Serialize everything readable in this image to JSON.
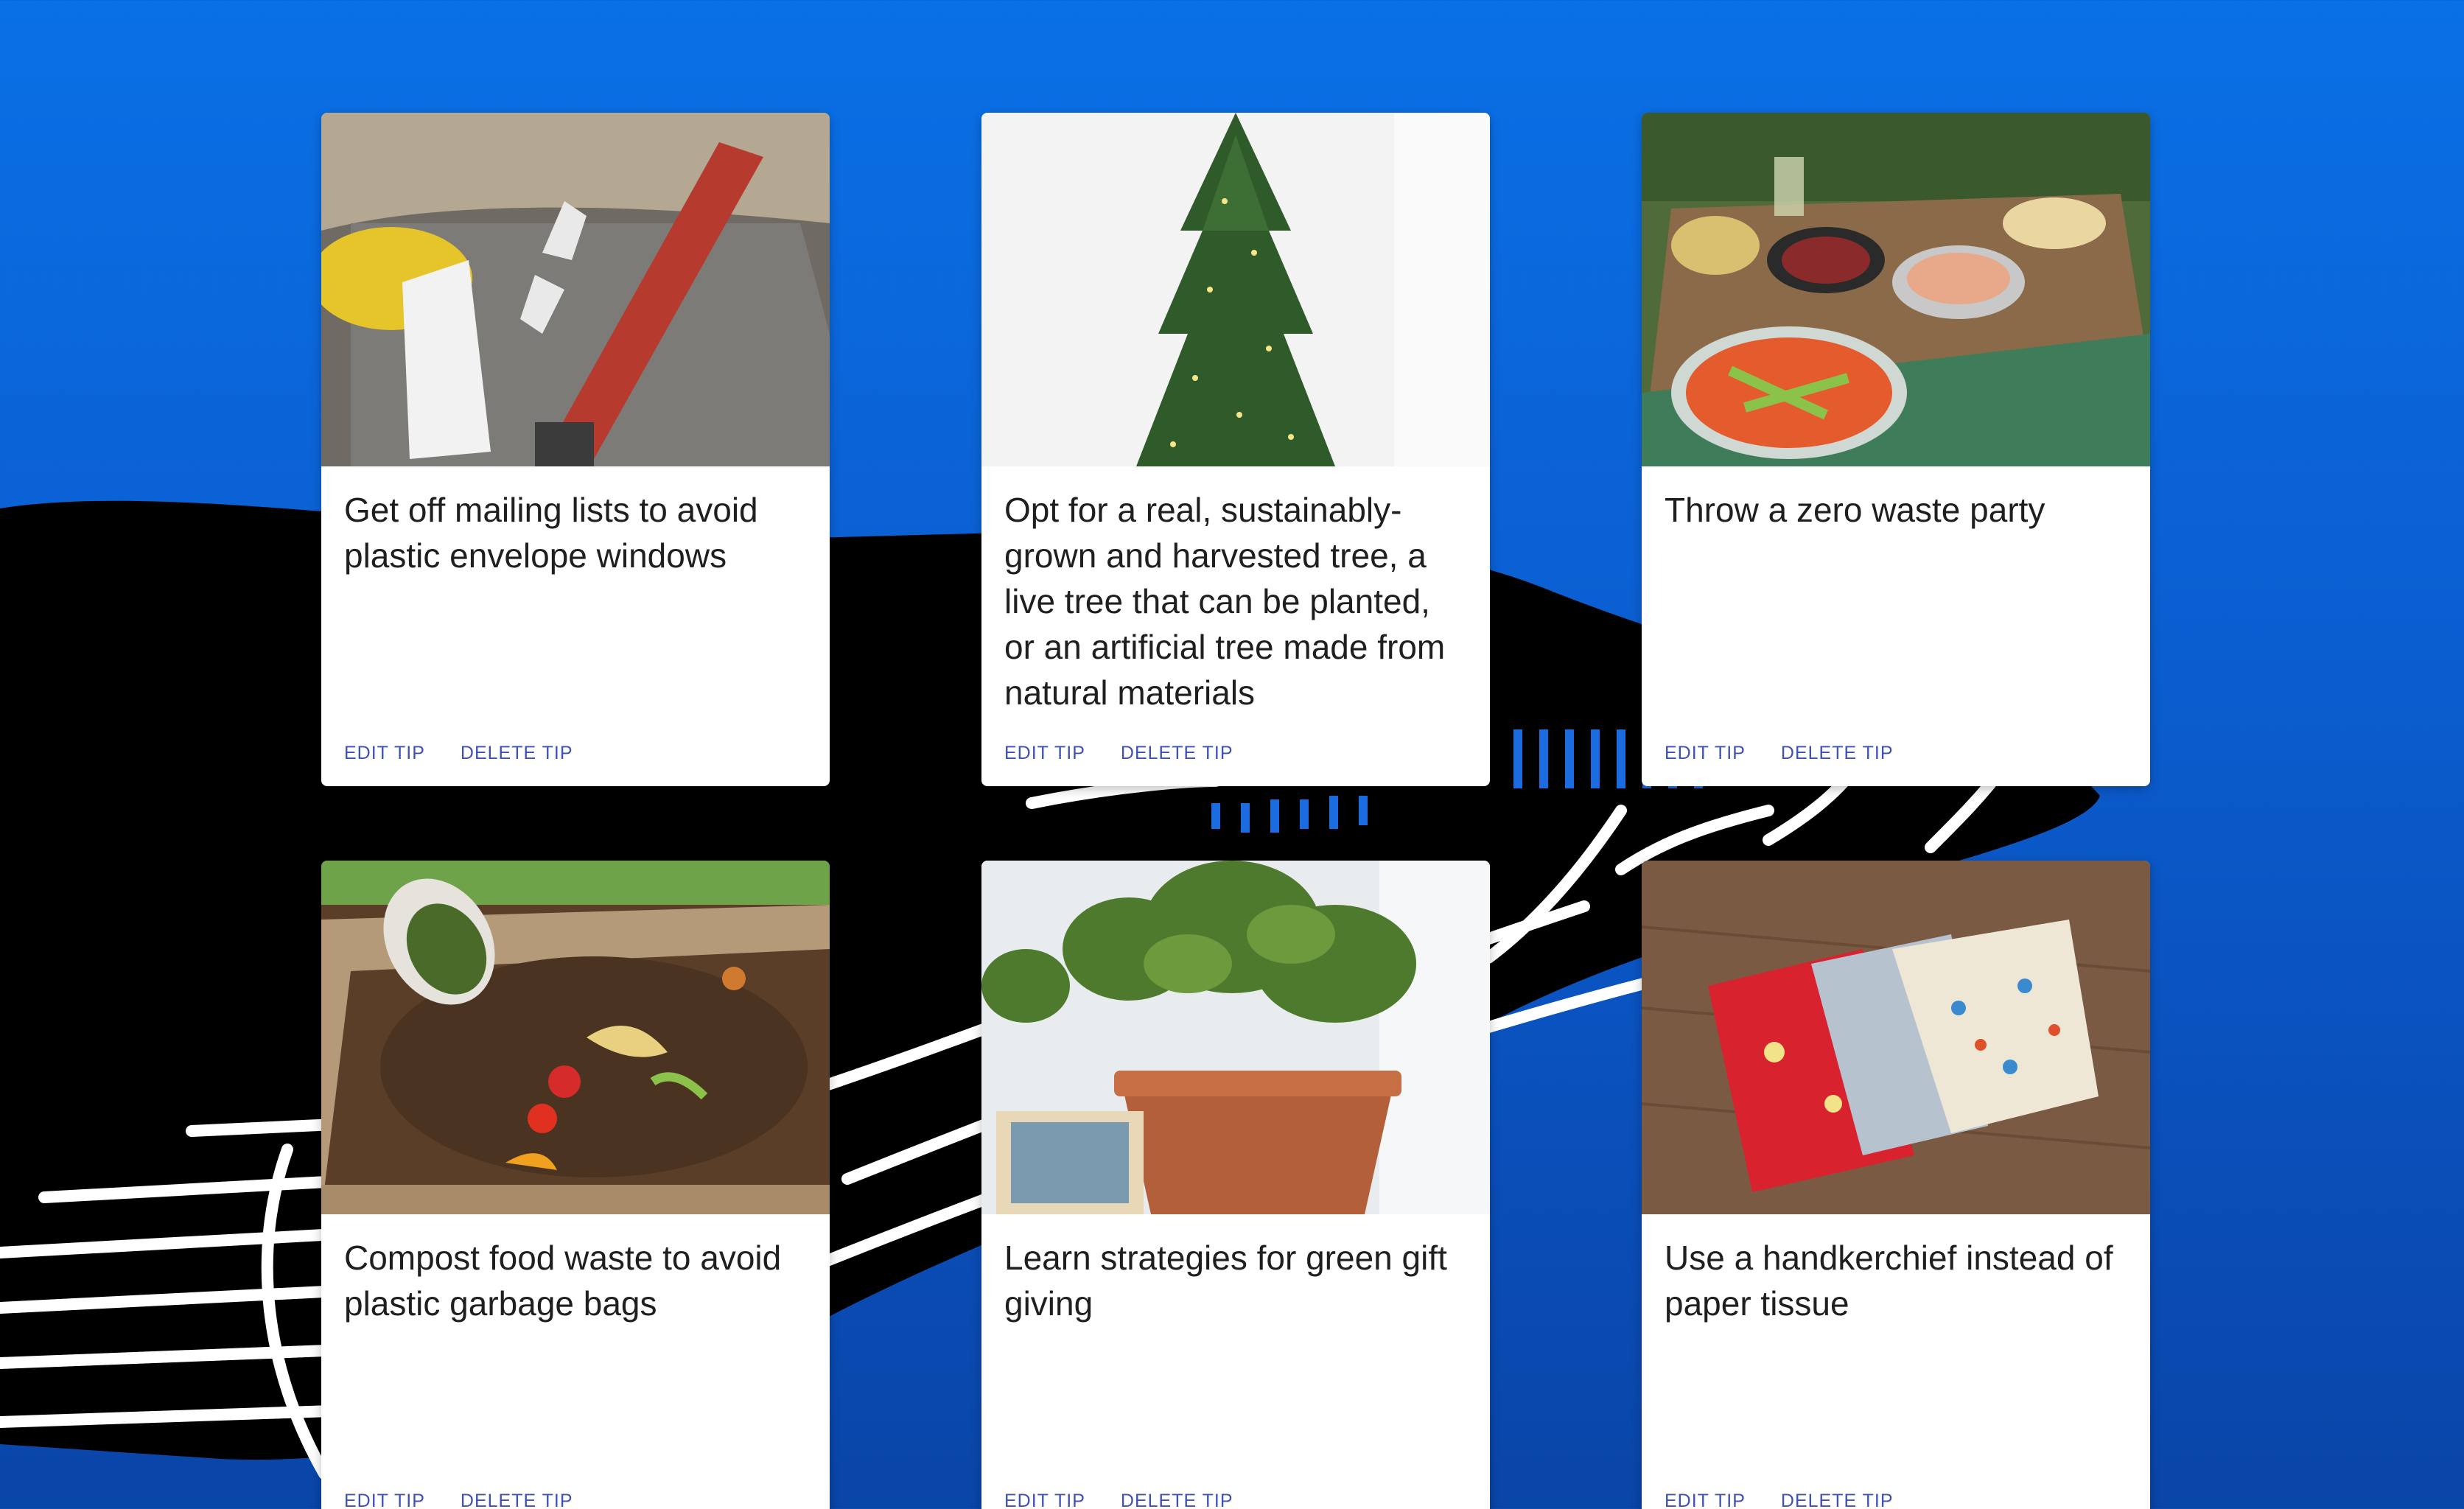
{
  "theme": {
    "accent": "#3f51b5",
    "background": "#0b5fd2"
  },
  "cards": [
    {
      "title": "Get off mailing lists to avoid plastic envelope windows",
      "image_icon": "mailbox-image",
      "edit_label": "EDIT TIP",
      "delete_label": "DELETE TIP"
    },
    {
      "title": "Opt for a real, sustainably-grown and harvested tree, a live tree that can be planted, or an artificial tree made from natural materials",
      "image_icon": "christmas-tree-image",
      "edit_label": "EDIT TIP",
      "delete_label": "DELETE TIP"
    },
    {
      "title": "Throw a zero waste party",
      "image_icon": "party-table-image",
      "edit_label": "EDIT TIP",
      "delete_label": "DELETE TIP"
    },
    {
      "title": "Compost food waste to avoid plastic garbage bags",
      "image_icon": "compost-image",
      "edit_label": "EDIT TIP",
      "delete_label": "DELETE TIP"
    },
    {
      "title": "Learn strategies for green gift giving",
      "image_icon": "potted-plant-image",
      "edit_label": "EDIT TIP",
      "delete_label": "DELETE TIP"
    },
    {
      "title": "Use a handkerchief instead of paper tissue",
      "image_icon": "handkerchief-image",
      "edit_label": "EDIT TIP",
      "delete_label": "DELETE TIP"
    }
  ]
}
